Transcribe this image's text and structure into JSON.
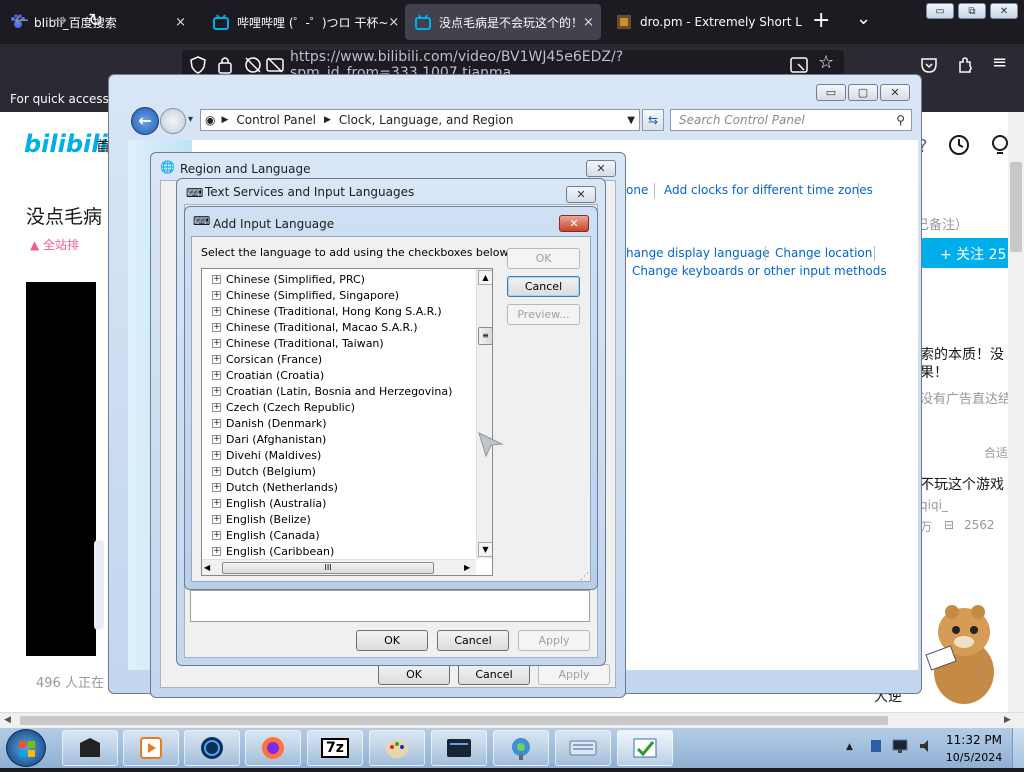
{
  "browser": {
    "tabs": [
      {
        "label": "bIibli_百度搜索",
        "close": "×"
      },
      {
        "label": "哔哩哔哩 (゜-゜)つロ 干杯~",
        "close": "×"
      },
      {
        "label": "没点毛病是不会玩这个的！",
        "close": "×"
      },
      {
        "label": "dro.pm - Extremely Short L",
        "close": "×"
      }
    ],
    "new_tab": "+",
    "tab_list": "⌄",
    "url": "https://www.bilibili.com/video/BV1WJ45e6EDZ/?spm_id_from=333.1007.tianma",
    "bookmarks_text": "For quick access,"
  },
  "window_controls": {
    "minimize": "▭",
    "restore": "⧉",
    "close": "✕"
  },
  "page": {
    "logo": "bilibili",
    "header_char": "首",
    "video_title": "没点毛病",
    "rank": "全站排",
    "author_note": "已备注）",
    "follow_button": "+ 关注 25",
    "side_text_1": "索的本质！没",
    "side_text_2": "果！",
    "side_text_3": "没有广告直达结",
    "side_text_4": "合适",
    "side_text_5": "不玩这个游戏",
    "side_text_6": "qiqi_",
    "side_text_7": "万",
    "side_text_8": "2562",
    "watching": "496 人正在",
    "bottom_text": "大逆"
  },
  "control_panel": {
    "breadcrumb_root": "Control Panel",
    "breadcrumb_section": "Clock, Language, and Region",
    "search_placeholder": "Search Control Panel",
    "link_zone": "one",
    "link_clocks": "Add clocks for different time zones",
    "link_display": "hange display language",
    "link_location": "Change location",
    "link_keyboards": "Change keyboards or other input methods",
    "ok": "OK",
    "cancel": "Cancel",
    "apply": "Apply"
  },
  "region_dialog": {
    "title": "Region and Language",
    "ok": "OK",
    "cancel": "Cancel",
    "apply": "Apply"
  },
  "text_services_dialog": {
    "title": "Text Services and Input Languages",
    "ok": "OK",
    "cancel": "Cancel",
    "apply": "Apply"
  },
  "add_language_dialog": {
    "title": "Add Input Language",
    "instruction": "Select the language to add using the checkboxes below.",
    "ok": "OK",
    "cancel": "Cancel",
    "preview": "Preview...",
    "languages": [
      "Chinese (Simplified, PRC)",
      "Chinese (Simplified, Singapore)",
      "Chinese (Traditional, Hong Kong S.A.R.)",
      "Chinese (Traditional, Macao S.A.R.)",
      "Chinese (Traditional, Taiwan)",
      "Corsican (France)",
      "Croatian (Croatia)",
      "Croatian (Latin, Bosnia and Herzegovina)",
      "Czech (Czech Republic)",
      "Danish (Denmark)",
      "Dari (Afghanistan)",
      "Divehi (Maldives)",
      "Dutch (Belgium)",
      "Dutch (Netherlands)",
      "English (Australia)",
      "English (Belize)",
      "English (Canada)",
      "English (Caribbean)"
    ],
    "hscroll_grip": "III"
  },
  "taskbar": {
    "time": "11:32 PM",
    "date": "10/5/2024",
    "apps": [
      "start-orb",
      "media",
      "player",
      "firefox-icon",
      "7z",
      "paint",
      "terminal",
      "network",
      "keyboard",
      "checklist"
    ],
    "sevenzip_label": "7z"
  }
}
